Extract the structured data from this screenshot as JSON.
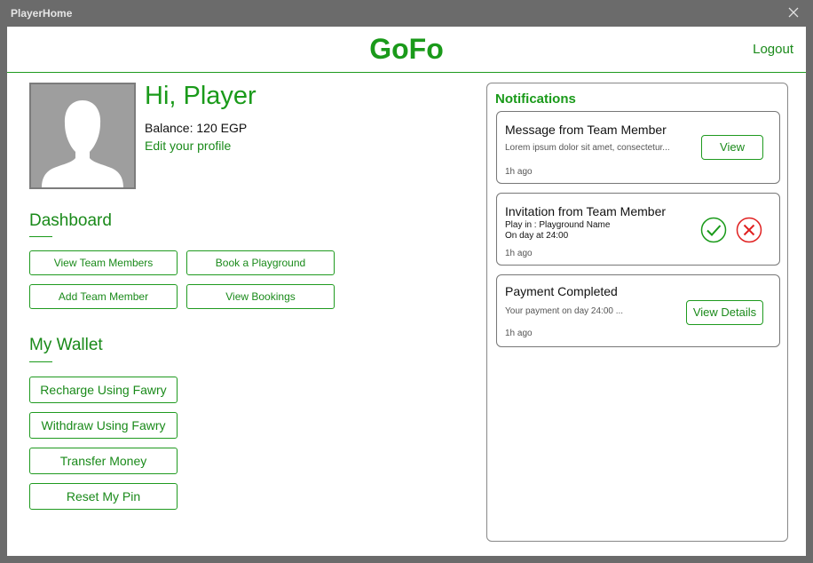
{
  "window": {
    "title": "PlayerHome",
    "close_icon": "close-icon"
  },
  "header": {
    "brand": "GoFo",
    "logout": "Logout"
  },
  "profile": {
    "greeting": "Hi, Player",
    "balance": "Balance: 120 EGP",
    "edit_link": "Edit your profile",
    "avatar_icon": "user-silhouette-icon"
  },
  "dashboard": {
    "title": "Dashboard",
    "buttons": [
      "View Team Members",
      "Book a Playground",
      "Add Team Member",
      "View Bookings"
    ]
  },
  "wallet": {
    "title": "My Wallet",
    "buttons": [
      "Recharge Using Fawry",
      "Withdraw Using Fawry",
      "Transfer Money",
      "Reset My Pin"
    ]
  },
  "notifications": {
    "title": "Notifications",
    "items": [
      {
        "title": "Message from Team Member",
        "body": "Lorem ipsum dolor sit amet, consectetur...",
        "time": "1h ago",
        "action": "View"
      },
      {
        "title": "Invitation from Team Member",
        "line1": "Play in : Playground Name",
        "line2": "On day at 24:00",
        "time": "1h ago",
        "accept_icon": "check-icon",
        "decline_icon": "x-icon"
      },
      {
        "title": "Payment Completed",
        "body": "Your payment on day 24:00 ...",
        "time": "1h ago",
        "action": "View Details"
      }
    ]
  },
  "colors": {
    "accent": "#1a9a1a",
    "decline": "#e02020",
    "window_chrome": "#6b6b6b",
    "avatar_bg": "#9e9e9e"
  }
}
